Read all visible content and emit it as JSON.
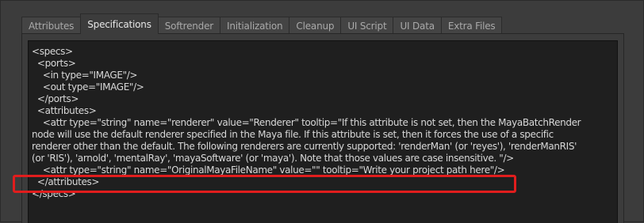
{
  "tabs": [
    {
      "label": "Attributes"
    },
    {
      "label": "Specifications"
    },
    {
      "label": "Softrender"
    },
    {
      "label": "Initialization"
    },
    {
      "label": "Cleanup"
    },
    {
      "label": "UI Script"
    },
    {
      "label": "UI Data"
    },
    {
      "label": "Extra Files"
    }
  ],
  "active_tab": "Specifications",
  "editor": {
    "lines": [
      "<specs>",
      "  <ports>",
      "    <in type=\"IMAGE\"/>",
      "    <out type=\"IMAGE\"/>",
      "  </ports>",
      "  <attributes>",
      "    <attr type=\"string\" name=\"renderer\" value=\"Renderer\" tooltip=\"If this attribute is not set, then the MayaBatchRender",
      "node will use the default renderer specified in the Maya file. If this attribute is set, then it forces the use of a specific",
      "renderer other than the default. The following renderers are currently supported: 'renderMan' (or 'reyes'), 'renderManRIS'",
      "(or 'RIS'), 'arnold', 'mentalRay', 'mayaSoftware' (or 'maya'). Note that those values are case insensitive. \"/>",
      "    <attr type=\"string\" name=\"OriginalMayaFileName\" value=\"\" tooltip=\"Write your project path here\"/>",
      "  </attributes>",
      "</specs>"
    ]
  },
  "highlight_color": "#e11d1d"
}
